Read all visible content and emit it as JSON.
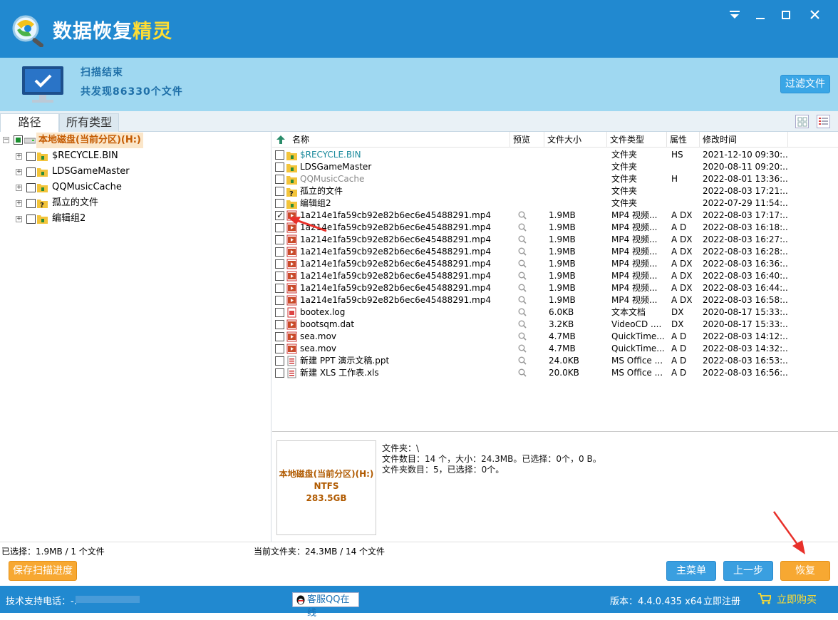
{
  "app": {
    "title_part1": "数据恢复",
    "title_part2": "精灵"
  },
  "scan": {
    "status": "扫描结束",
    "found": "共发现86330个文件",
    "filter_button": "过滤文件"
  },
  "tabs": {
    "path": "路径",
    "all_types": "所有类型"
  },
  "tree": {
    "root": "本地磁盘(当前分区)(H:)",
    "children": [
      "$RECYCLE.BIN",
      "LDSGameMaster",
      "QQMusicCache",
      "孤立的文件",
      "编辑组2"
    ]
  },
  "columns": {
    "name": "名称",
    "preview": "预览",
    "size": "文件大小",
    "type": "文件类型",
    "attr": "属性",
    "modified": "修改时间"
  },
  "files": [
    {
      "name": "$RECYCLE.BIN",
      "size": "",
      "type": "文件夹",
      "attr": "HS",
      "modified": "2021-12-10 09:30:...",
      "kind": "folder",
      "color": "#1b8a9c",
      "checked": false,
      "preview": false
    },
    {
      "name": "LDSGameMaster",
      "size": "",
      "type": "文件夹",
      "attr": "",
      "modified": "2020-08-11 09:20:...",
      "kind": "folder",
      "color": "#000000",
      "checked": false,
      "preview": false
    },
    {
      "name": "QQMusicCache",
      "size": "",
      "type": "文件夹",
      "attr": "H",
      "modified": "2022-08-01 13:36:...",
      "kind": "folder",
      "color": "#888888",
      "checked": false,
      "preview": false
    },
    {
      "name": "孤立的文件",
      "size": "",
      "type": "文件夹",
      "attr": "",
      "modified": "2022-08-03 17:21:...",
      "kind": "orphan",
      "color": "#000000",
      "checked": false,
      "preview": false
    },
    {
      "name": "编辑组2",
      "size": "",
      "type": "文件夹",
      "attr": "",
      "modified": "2022-07-29 11:54:...",
      "kind": "folder",
      "color": "#000000",
      "checked": false,
      "preview": false
    },
    {
      "name": "1a214e1fa59cb92e82b6ec6e45488291.mp4",
      "size": "1.9MB",
      "type": "MP4 视频...",
      "attr": "A DX",
      "modified": "2022-08-03 17:17:...",
      "kind": "video",
      "color": "#000000",
      "checked": true,
      "preview": true
    },
    {
      "name": "1a214e1fa59cb92e82b6ec6e45488291.mp4",
      "size": "1.9MB",
      "type": "MP4 视频...",
      "attr": "A D",
      "modified": "2022-08-03 16:18:...",
      "kind": "video",
      "color": "#000000",
      "checked": false,
      "preview": true
    },
    {
      "name": "1a214e1fa59cb92e82b6ec6e45488291.mp4",
      "size": "1.9MB",
      "type": "MP4 视频...",
      "attr": "A DX",
      "modified": "2022-08-03 16:27:...",
      "kind": "video",
      "color": "#000000",
      "checked": false,
      "preview": true
    },
    {
      "name": "1a214e1fa59cb92e82b6ec6e45488291.mp4",
      "size": "1.9MB",
      "type": "MP4 视频...",
      "attr": "A DX",
      "modified": "2022-08-03 16:28:...",
      "kind": "video",
      "color": "#000000",
      "checked": false,
      "preview": true
    },
    {
      "name": "1a214e1fa59cb92e82b6ec6e45488291.mp4",
      "size": "1.9MB",
      "type": "MP4 视频...",
      "attr": "A DX",
      "modified": "2022-08-03 16:36:...",
      "kind": "video",
      "color": "#000000",
      "checked": false,
      "preview": true
    },
    {
      "name": "1a214e1fa59cb92e82b6ec6e45488291.mp4",
      "size": "1.9MB",
      "type": "MP4 视频...",
      "attr": "A DX",
      "modified": "2022-08-03 16:40:...",
      "kind": "video",
      "color": "#000000",
      "checked": false,
      "preview": true
    },
    {
      "name": "1a214e1fa59cb92e82b6ec6e45488291.mp4",
      "size": "1.9MB",
      "type": "MP4 视频...",
      "attr": "A DX",
      "modified": "2022-08-03 16:44:...",
      "kind": "video",
      "color": "#000000",
      "checked": false,
      "preview": true
    },
    {
      "name": "1a214e1fa59cb92e82b6ec6e45488291.mp4",
      "size": "1.9MB",
      "type": "MP4 视频...",
      "attr": "A DX",
      "modified": "2022-08-03 16:58:...",
      "kind": "video",
      "color": "#000000",
      "checked": false,
      "preview": true
    },
    {
      "name": "bootex.log",
      "size": "6.0KB",
      "type": "文本文档",
      "attr": "DX",
      "modified": "2020-08-17 15:33:...",
      "kind": "doc",
      "color": "#000000",
      "checked": false,
      "preview": true
    },
    {
      "name": "bootsqm.dat",
      "size": "3.2KB",
      "type": "VideoCD ....",
      "attr": "DX",
      "modified": "2020-08-17 15:33:...",
      "kind": "video",
      "color": "#000000",
      "checked": false,
      "preview": true
    },
    {
      "name": "sea.mov",
      "size": "4.7MB",
      "type": "QuickTime...",
      "attr": "A D",
      "modified": "2022-08-03 14:12:...",
      "kind": "video",
      "color": "#000000",
      "checked": false,
      "preview": true
    },
    {
      "name": "sea.mov",
      "size": "4.7MB",
      "type": "QuickTime...",
      "attr": "A D",
      "modified": "2022-08-03 14:32:...",
      "kind": "video",
      "color": "#000000",
      "checked": false,
      "preview": true
    },
    {
      "name": "新建 PPT 演示文稿.ppt",
      "size": "24.0KB",
      "type": "MS Office ...",
      "attr": "A D",
      "modified": "2022-08-03 16:53:...",
      "kind": "office",
      "color": "#000000",
      "checked": false,
      "preview": true
    },
    {
      "name": "新建 XLS 工作表.xls",
      "size": "20.0KB",
      "type": "MS Office ...",
      "attr": "A D",
      "modified": "2022-08-03 16:56:...",
      "kind": "office",
      "color": "#000000",
      "checked": false,
      "preview": true
    }
  ],
  "detail": {
    "drive_name": "本地磁盘(当前分区)(H:)",
    "fs": "NTFS",
    "capacity": "283.5GB",
    "line1": "文件夹：\\",
    "line2": "文件数目：14 个，大小：24.3MB。已选择：0个，0 B。",
    "line3": "文件夹数目：5，已选择：0个。"
  },
  "status": {
    "selected": "已选择：1.9MB / 1 个文件",
    "current_folder": "当前文件夹：24.3MB / 14 个文件"
  },
  "buttons": {
    "save_progress": "保存扫描进度",
    "main_menu": "主菜单",
    "prev": "上一步",
    "recover": "恢复"
  },
  "footer": {
    "support": "技术支持电话：-.",
    "qq": "客服QQ在线",
    "version": "版本：4.4.0.435 x64",
    "register": "立即注册",
    "buy": "立即购买"
  },
  "colors": {
    "titlebar": "#2189d0",
    "scanbar": "#9fd8f1",
    "accent_orange": "#f7a832",
    "accent_blue": "#3a9fe0",
    "annotation_red": "#e8302a"
  }
}
